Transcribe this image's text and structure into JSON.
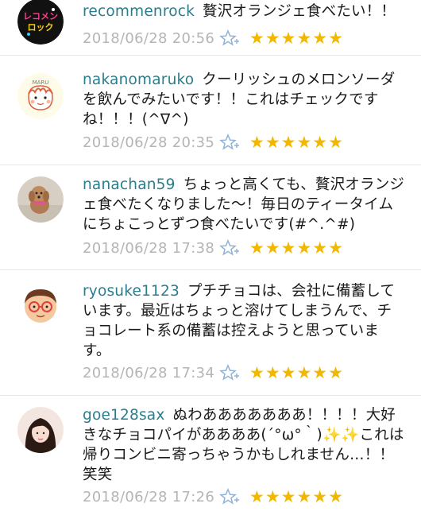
{
  "comments": [
    {
      "username": "recommenrock",
      "text": "贅沢オランジェ食べたい！！",
      "timestamp": "2018/06/28 20:56",
      "stars": "★★★★★★",
      "star_count": 6,
      "avatar": "recommenrock-logo"
    },
    {
      "username": "nakanomaruko",
      "text": "クーリッシュのメロンソーダを飲んでみたいです！！これはチェックですね！！！(^∇^)",
      "timestamp": "2018/06/28 20:35",
      "stars": "★★★★★★",
      "star_count": 6,
      "avatar": "cartoon-face",
      "avatar_label": "MARU"
    },
    {
      "username": "nanachan59",
      "text": "ちょっと高くても、贅沢オランジェ食べたくなりました〜！毎日のティータイムにちょこっとずつ食べたいです(#^.^#)",
      "timestamp": "2018/06/28 17:38",
      "stars": "★★★★★★",
      "star_count": 6,
      "avatar": "dog-photo"
    },
    {
      "username": "ryosuke1123",
      "text": "プチチョコは、会社に備蓄しています。最近はちょっと溶けてしまうんで、チョコレート系の備蓄は控えようと思っています。",
      "timestamp": "2018/06/28 17:34",
      "stars": "★★★★★★",
      "star_count": 6,
      "avatar": "boy-with-glasses"
    },
    {
      "username": "goe128sax",
      "text": "ぬわあああああああ！！！！大好きなチョコパイがああああ(´°ω°｀)✨✨これは帰りコンビニ寄っちゃうかもしれません…！！笑笑",
      "timestamp": "2018/06/28 17:26",
      "stars": "★★★★★★",
      "star_count": 6,
      "avatar": "girl-photo"
    }
  ],
  "colors": {
    "username": "#2a7d8c",
    "star": "#f2b800",
    "timestamp": "#b5b5b5",
    "divider": "#e6e6e6"
  }
}
